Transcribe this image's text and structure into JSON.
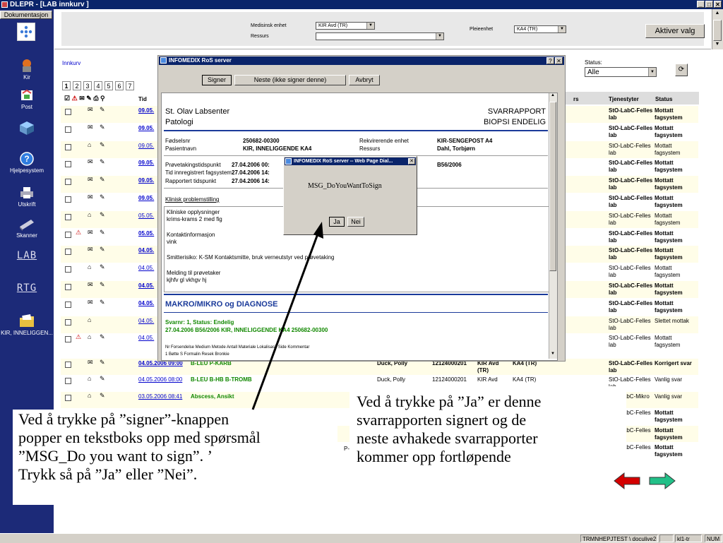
{
  "window": {
    "title": "DLEPR - [LAB innkurv ]",
    "min": "_",
    "max": "□",
    "close": "✕"
  },
  "sidebar": {
    "doc_tab": "Dokumentasjon",
    "items": [
      {
        "label": "Kir",
        "icon": "surgeon-icon"
      },
      {
        "label": "Post",
        "icon": "post-icon"
      },
      {
        "label": "",
        "icon": "cube-icon"
      },
      {
        "label": "Hjelpesystem",
        "icon": "help-icon"
      },
      {
        "label": "Utskrift",
        "icon": "printer-icon"
      },
      {
        "label": "Skanner",
        "icon": "scanner-icon"
      },
      {
        "label": "LAB",
        "icon": "lab-icon"
      },
      {
        "label": "RTG",
        "icon": "rtg-icon"
      },
      {
        "label": "KIR, INNELIGGEN...",
        "icon": "folder-icon"
      }
    ]
  },
  "topbar": {
    "medisinsk_label": "Medisinsk enhet",
    "medisinsk_value": "KIR Avd (TR)",
    "ressurs_label": "Ressurs",
    "ressurs_value": "",
    "pleieenhet_label": "Pleieenhet",
    "pleieenhet_value": "KA4 (TR)",
    "aktiver_button": "Aktiver valg"
  },
  "list": {
    "innkurv_label": "Innkurv",
    "tabs": [
      "1",
      "2",
      "3",
      "4",
      "5",
      "6",
      "7"
    ],
    "col_tid": "Tid",
    "col_rs": "rs",
    "col_tjenestyter": "Tjenestyter",
    "col_status": "Status",
    "status_label": "Status:",
    "status_value": "Alle",
    "rows": [
      {
        "date": "09.05.",
        "bold": true,
        "tj": "StO-LabC-Felles lab",
        "st": "Mottatt fagsystem",
        "tjb": true
      },
      {
        "date": "09.05.",
        "bold": true,
        "tj": "StO-LabC-Felles lab",
        "st": "Mottatt fagsystem",
        "tjb": true
      },
      {
        "date": "09.05.",
        "bold": false,
        "tj": "StO-LabC-Felles lab",
        "st": "Mottatt fagsystem",
        "tjb": false
      },
      {
        "date": "09.05.",
        "bold": true,
        "tj": "StO-LabC-Felles lab",
        "st": "Mottatt fagsystem",
        "tjb": true
      },
      {
        "date": "09.05.",
        "bold": true,
        "tj": "StO-LabC-Felles lab",
        "st": "Mottatt fagsystem",
        "tjb": true
      },
      {
        "date": "09.05.",
        "bold": true,
        "tj": "StO-LabC-Felles lab",
        "st": "Mottatt fagsystem",
        "tjb": true
      },
      {
        "date": "05.05.",
        "bold": false,
        "tj": "StO-LabC-Felles lab",
        "st": "Mottatt fagsystem",
        "tjb": false
      },
      {
        "date": "05.05.",
        "bold": true,
        "tj": "StO-LabC-Felles lab",
        "st": "Mottatt fagsystem",
        "tjb": true
      },
      {
        "date": "04.05.",
        "bold": true,
        "tj": "StO-LabC-Felles lab",
        "st": "Mottatt fagsystem",
        "tjb": true
      },
      {
        "date": "04.05.",
        "bold": false,
        "tj": "StO-LabC-Felles lab",
        "st": "Mottatt fagsystem",
        "tjb": false
      },
      {
        "date": "04.05.",
        "bold": true,
        "tj": "StO-LabC-Felles lab",
        "st": "Mottatt fagsystem",
        "tjb": true
      },
      {
        "date": "04.05.",
        "bold": true,
        "tj": "StO-LabC-Felles lab",
        "st": "Mottatt fagsystem",
        "tjb": true
      },
      {
        "date": "04.05.",
        "bold": false,
        "tj": "StO-LabC-Felles lab",
        "st": "Slettet mottak",
        "tjb": false
      },
      {
        "date": "04.05.",
        "bold": false,
        "tj": "StO-LabC-Felles lab",
        "st": "Mottatt fagsystem",
        "tjb": false
      }
    ],
    "lower_rows": [
      {
        "date": "04.05.2006 09:00",
        "test": "B-LEU P-KARB",
        "patient": "Duck, Polly",
        "id": "12124000201",
        "avd": "KIR Avd (TR)",
        "pleie": "KA4 (TR)",
        "tj": "StO-LabC-Felles lab",
        "st": "Korrigert svar"
      },
      {
        "date": "04.05.2006 08:00",
        "test": "B-LEU B-HB B-TROMB",
        "patient": "Duck, Polly",
        "id": "12124000201",
        "avd": "KIR Avd",
        "pleie": "KA4 (TR)",
        "tj": "StO-LabC-Felles lab",
        "st": "Vanlig svar"
      },
      {
        "date": "03.05.2006 08:41",
        "test": "Abscess, Ansikt",
        "patient": "",
        "id": "",
        "avd": "",
        "pleie": "",
        "tj": "StO-LabC-Mikro",
        "st": "Vanlig svar"
      },
      {
        "date": "",
        "test": "",
        "patient": "",
        "id": "",
        "avd": "",
        "pleie": "",
        "tj": "StO-LabC-Felles lab",
        "st": "Mottatt fagsystem"
      },
      {
        "date": "",
        "test": "",
        "patient": "",
        "id": "",
        "avd": "",
        "pleie": "",
        "tj": "StO-LabC-Felles lab",
        "st": "Mottatt fagsystem"
      },
      {
        "date": "",
        "test": "",
        "patient": "",
        "id": "",
        "avd": "",
        "pleie": "",
        "tj": "StO-LabC-Felles lab",
        "st": "Mottatt fagsystem"
      }
    ],
    "lower_p_marker": "P-"
  },
  "dialog": {
    "title": "INFOMEDIX RoS server",
    "help": "?",
    "close": "✕",
    "signer_button": "Signer",
    "neste_button": "Neste (ikke signer denne)",
    "avbryt_button": "Avbryt",
    "report": {
      "lab_name": "St. Olav Labsenter",
      "dept": "Patologi",
      "type_line1": "SVARRAPPORT",
      "type_line2": "BIOPSI ENDELIG",
      "fodselsnr_label": "Fødselsnr",
      "fodselsnr": "250682-00300",
      "pasient_label": "Pasientnavn",
      "pasient": "KIR, INNELIGGENDE KA4",
      "rekv_label": "Rekvirerende enhet",
      "rekv": "KIR-SENGEPOST A4",
      "ressurs_label": "Ressurs",
      "ressurs": "Dahl, Torbjørn",
      "prove_label": "Prøvetakingstidspunkt",
      "prove": "27.04.2006 00:",
      "innreg_label": "Tid innregistrert fagsystem",
      "innreg": "27.04.2006 14:",
      "rapp_label": "Rapportert tidspunkt",
      "rapp": "27.04.2006 14:",
      "ref": "B56/2006",
      "klinisk_heading": "Klinisk problemstilling",
      "klin1": "Kliniske opplysninger",
      "klin2": "krims-krams 2 med fig",
      "kontakt1": "Kontaktinformasjon",
      "kontakt2": "vink",
      "smitte": "Smitterisiko: K-SM Kontaktsmitte, bruk verneutstyr ved prøvetaking",
      "melding1": "Melding til prøvetaker",
      "melding2": "kjhfv gl vkhgv hj",
      "makro": "MAKRO/MIKRO og DIAGNOSE",
      "svarnr": "Svarnr: 1, Status: Endelig",
      "svarline": "27.04.2006 B56/2006 KIR, INNELIGGENDE KA4 250682-00300",
      "footer1": "Nr Forsendelse Medium Metode Antall Materiale Lokalisasj. Side Kommentar",
      "footer2": "1 Bøtte S Formalin Resek Bronkie"
    }
  },
  "msgbox": {
    "title": "INFOMEDIX RoS server -- Web Page Dial...",
    "close": "✕",
    "message": "MSG_DoYouWantToSign",
    "ja": "Ja",
    "nei": "Nei"
  },
  "annotations": {
    "left": [
      "Ved å trykke på ”signer”-knappen",
      "popper en tekstboks opp med spørsmål",
      "”MSG_Do you want to sign”. ’",
      "Trykk så på ”Ja” eller ”Nei”."
    ],
    "right": [
      "Ved å trykke på ”Ja” er denne",
      "svarrapporten signert og de",
      "neste avhakede svarrapporter",
      "kommer opp fortløpende"
    ]
  },
  "statusbar": {
    "pane1": "TRMNHEPJTEST \\ doculive2",
    "pane2": "",
    "pane3": "kl1-tr",
    "pane4": "NUM"
  },
  "colors": {
    "titlebar": "#0a246a",
    "sidebar": "#1c2a78",
    "arrow_left": "#d40000",
    "arrow_right": "#22c088",
    "link": "#0000cc",
    "green": "#118800"
  }
}
